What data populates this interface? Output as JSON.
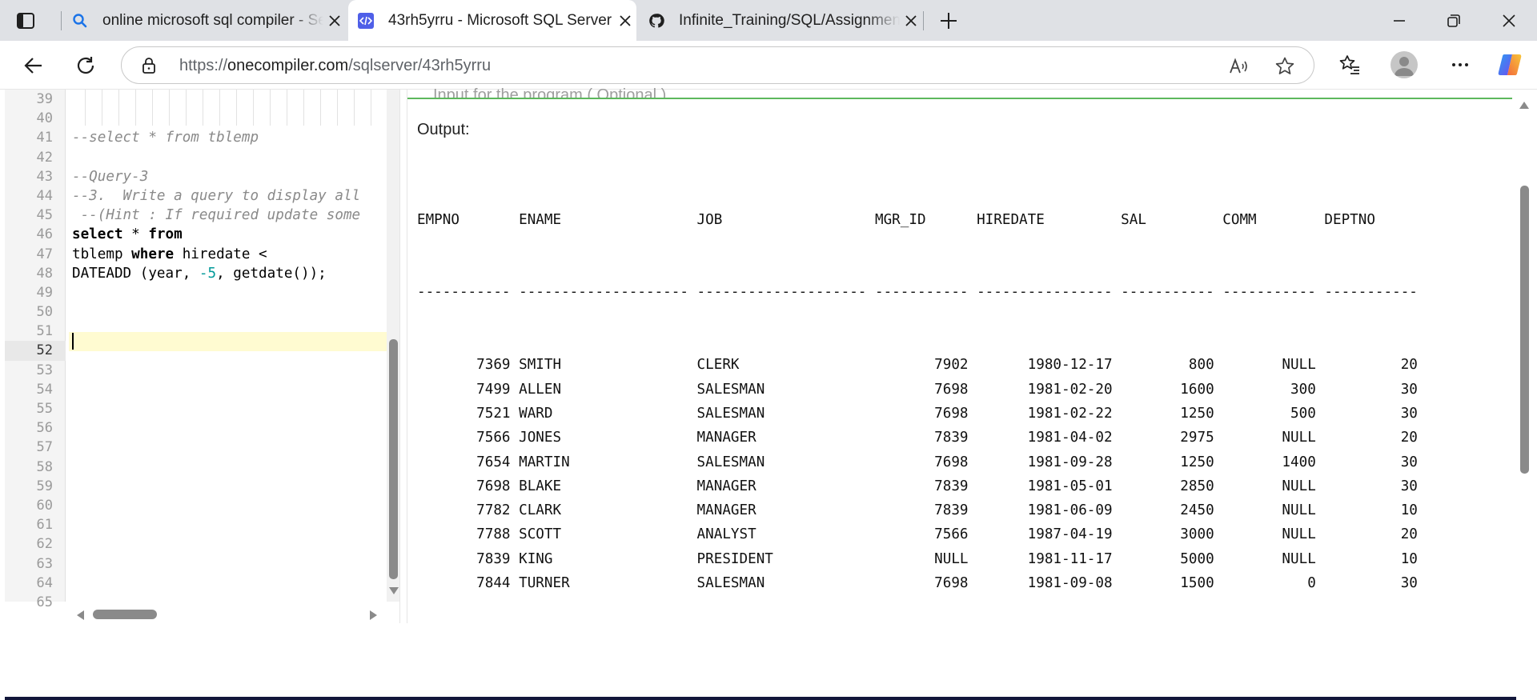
{
  "browser": {
    "tabs": [
      {
        "title": "online microsoft sql compiler - Se",
        "favicon": "search-icon"
      },
      {
        "title": "43rh5yrru - Microsoft SQL Server",
        "favicon": "code-icon"
      },
      {
        "title": "Infinite_Training/SQL/Assignment",
        "favicon": "github-icon"
      }
    ],
    "url_scheme": "https://",
    "url_host": "onecompiler.com",
    "url_path": "/sqlserver/43rh5yrru"
  },
  "editor": {
    "line_numbers": [
      "39",
      "40",
      "41",
      "42",
      "43",
      "44",
      "45",
      "46",
      "47",
      "48",
      "49",
      "50",
      "51",
      "52",
      "53",
      "54",
      "55",
      "56",
      "57",
      "58",
      "59",
      "60",
      "61",
      "62",
      "63",
      "64",
      "65"
    ],
    "active_line": "52",
    "lines": {
      "l41": "--select * from tblemp",
      "l43": "--Query-3",
      "l44": "--3.  Write a query to display all",
      "l45": " --(Hint : If required update some",
      "l46_kw1": "select",
      "l46_rest": " * ",
      "l46_kw2": "from",
      "l47_a": "tblemp ",
      "l47_kw": "where",
      "l47_b": " hiredate <",
      "l48_a": "DATEADD (year, ",
      "l48_num": "-5",
      "l48_b": ", getdate());"
    }
  },
  "output": {
    "input_hint": "Input for the program ( Optional )",
    "label": "Output:",
    "header": "EMPNO       ENAME                JOB                  MGR_ID      HIREDATE         SAL         COMM        DEPTNO",
    "separator": "----------- -------------------- -------------------- ----------- ---------------- ----------- ----------- -----------",
    "rows": [
      "       7369 SMITH                CLERK                       7902       1980-12-17         800        NULL          20",
      "       7499 ALLEN                SALESMAN                    7698       1981-02-20        1600         300          30",
      "       7521 WARD                 SALESMAN                    7698       1981-02-22        1250         500          30",
      "       7566 JONES                MANAGER                     7839       1981-04-02        2975        NULL          20",
      "       7654 MARTIN               SALESMAN                    7698       1981-09-28        1250        1400          30",
      "       7698 BLAKE                MANAGER                     7839       1981-05-01        2850        NULL          30",
      "       7782 CLARK                MANAGER                     7839       1981-06-09        2450        NULL          10",
      "       7788 SCOTT                ANALYST                     7566       1987-04-19        3000        NULL          20",
      "       7839 KING                 PRESIDENT                   NULL       1981-11-17        5000        NULL          10",
      "       7844 TURNER               SALESMAN                    7698       1981-09-08        1500           0          30"
    ]
  },
  "colors": {
    "tabstrip": "#dfe1e5",
    "active_line": "#fffbd1",
    "divider_green": "#5cb85c",
    "number_literal": "#009999",
    "comment": "#8a8a8a"
  }
}
